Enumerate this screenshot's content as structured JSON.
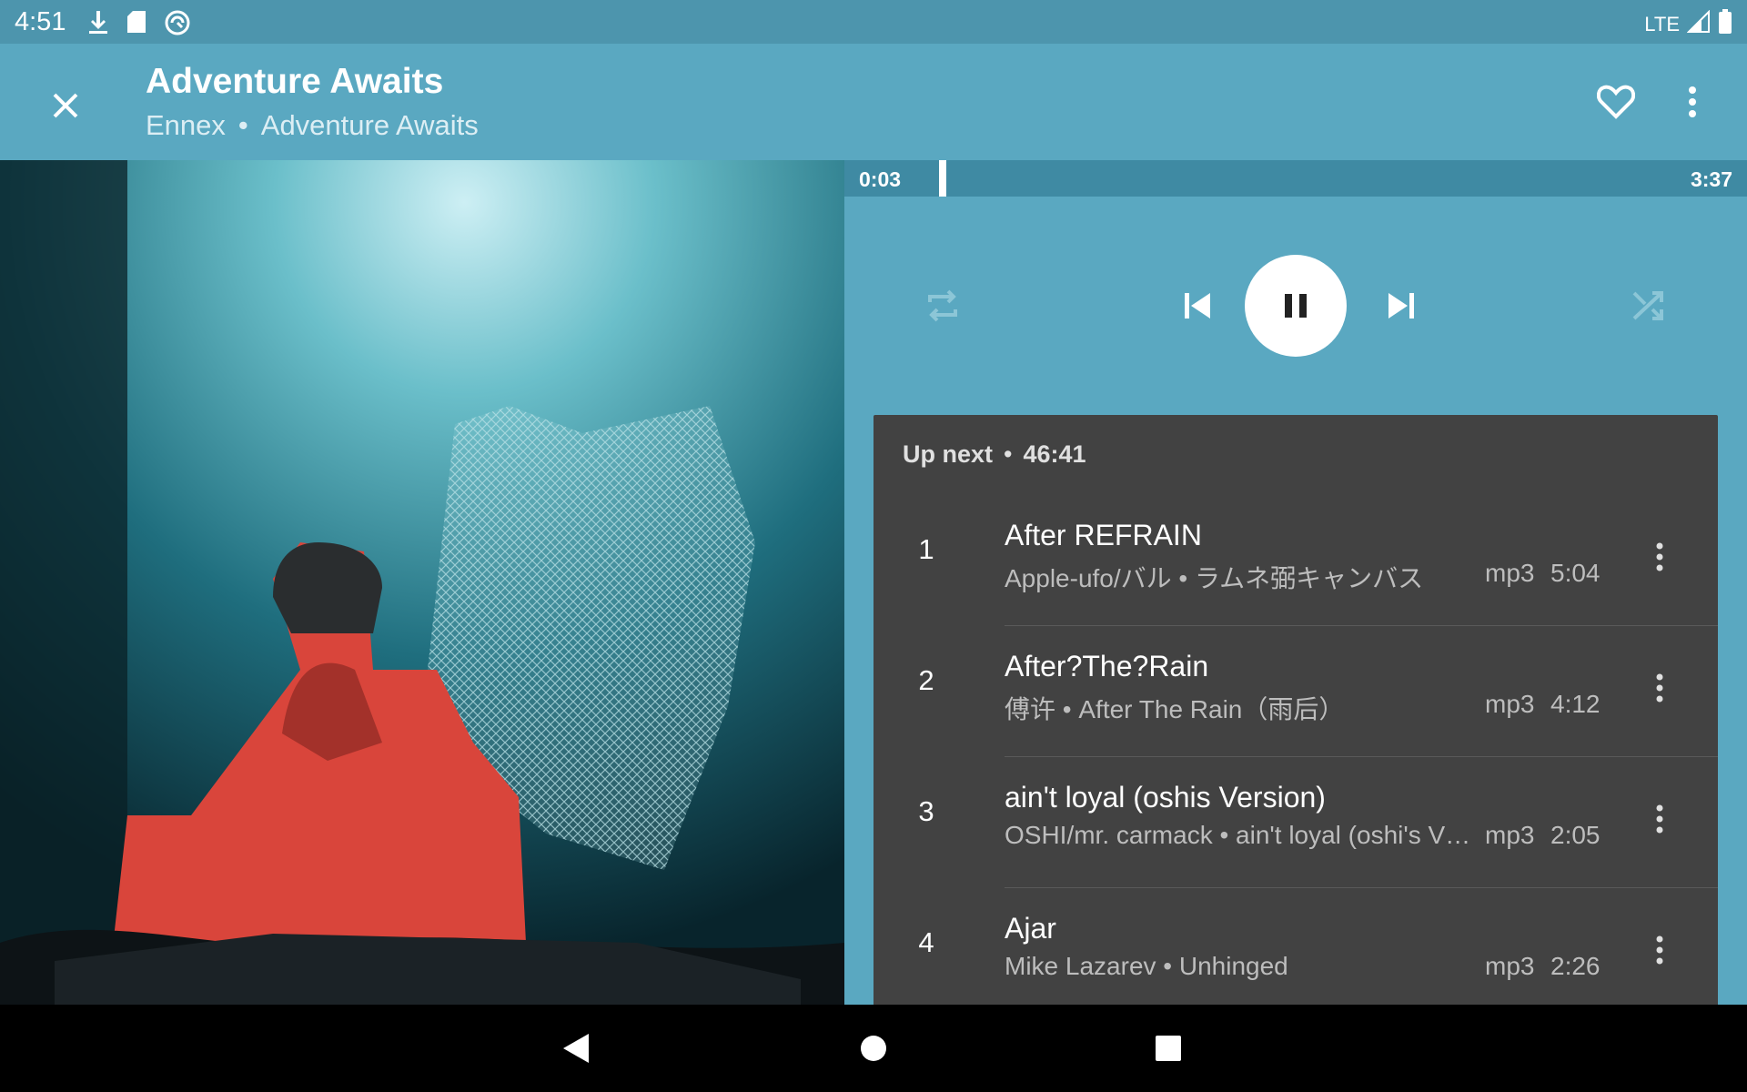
{
  "status_bar": {
    "time": "4:51",
    "network": "LTE",
    "icons": [
      "download-arrow-icon",
      "sd-card-icon",
      "sync-icon",
      "signal-icon",
      "battery-icon"
    ]
  },
  "header": {
    "title": "Adventure Awaits",
    "artist": "Ennex",
    "separator": "•",
    "album": "Adventure Awaits"
  },
  "player": {
    "current_time": "0:03",
    "duration": "3:37",
    "progress_fraction": 0.014,
    "state": "playing"
  },
  "queue": {
    "label": "Up next",
    "separator": "•",
    "total": "46:41",
    "items": [
      {
        "num": "1",
        "title": "After REFRAIN",
        "subtitle": "Apple-ufo/バル • ラムネ弼キャンバス",
        "format": "mp3",
        "length": "5:04"
      },
      {
        "num": "2",
        "title": "After?The?Rain",
        "subtitle": "傅许 • After The Rain（雨后）",
        "format": "mp3",
        "length": "4:12"
      },
      {
        "num": "3",
        "title": "ain't loyal (oshis Version)",
        "subtitle": "OSHI/mr. carmack • ain't loyal (oshi's V…",
        "format": "mp3",
        "length": "2:05"
      },
      {
        "num": "4",
        "title": "Ajar",
        "subtitle": "Mike Lazarev • Unhinged",
        "format": "mp3",
        "length": "2:26"
      }
    ]
  },
  "colors": {
    "accent": "#5aa8c1",
    "status_bar": "#4d95ad",
    "queue_bg": "#424242"
  }
}
